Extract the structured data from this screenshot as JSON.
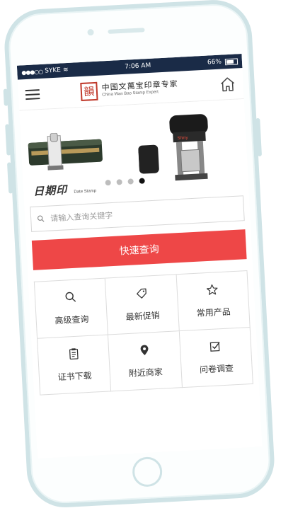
{
  "status_bar": {
    "carrier": "SYKE",
    "time": "7:06 AM",
    "battery": "66%"
  },
  "header": {
    "logo_mark": "韻",
    "logo_title": "中国文萬宝印章专家",
    "logo_subtitle": "China Wan Bao Stamp Expert"
  },
  "banner": {
    "caption_cn": "日期印",
    "caption_en": "Date Stamp",
    "stamp_brand": "Shiny",
    "slides_count": 4,
    "active_slide": 4
  },
  "search": {
    "placeholder": "请输入查询关键字",
    "button_label": "快速查询"
  },
  "grid_items": [
    {
      "icon": "search-icon",
      "label": "高级查询"
    },
    {
      "icon": "tag-icon",
      "label": "最新促销"
    },
    {
      "icon": "star-icon",
      "label": "常用产品"
    },
    {
      "icon": "clipboard-icon",
      "label": "证书下载"
    },
    {
      "icon": "location-pin-icon",
      "label": "附近商家"
    },
    {
      "icon": "checkbox-icon",
      "label": "问卷调查"
    }
  ],
  "colors": {
    "accent_red": "#ee4747",
    "status_bar": "#1a2b47",
    "phone_frame": "#cfe3e6"
  }
}
